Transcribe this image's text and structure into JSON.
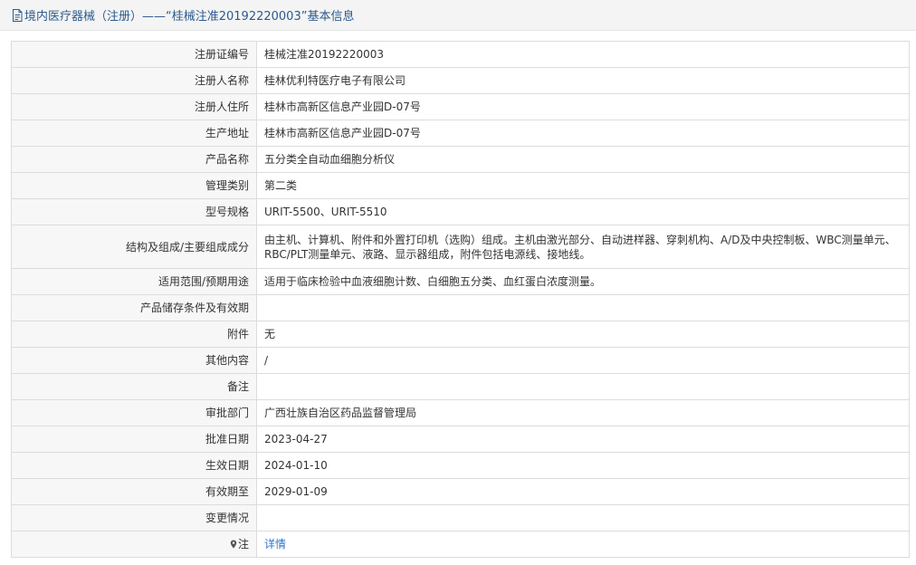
{
  "header": {
    "title": "境内医疗器械（注册）——“桂械注准20192220003”基本信息",
    "icon": "document-icon"
  },
  "rows": [
    {
      "label": "注册证编号",
      "value": "桂械注准20192220003"
    },
    {
      "label": "注册人名称",
      "value": "桂林优利特医疗电子有限公司"
    },
    {
      "label": "注册人住所",
      "value": "桂林市高新区信息产业园D-07号"
    },
    {
      "label": "生产地址",
      "value": "桂林市高新区信息产业园D-07号"
    },
    {
      "label": "产品名称",
      "value": "五分类全自动血细胞分析仪"
    },
    {
      "label": "管理类别",
      "value": "第二类"
    },
    {
      "label": "型号规格",
      "value": "URIT-5500、URIT-5510"
    },
    {
      "label": "结构及组成/主要组成成分",
      "value": "由主机、计算机、附件和外置打印机（选购）组成。主机由激光部分、自动进样器、穿刺机构、A/D及中央控制板、WBC测量单元、RBC/PLT测量单元、液路、显示器组成，附件包括电源线、接地线。"
    },
    {
      "label": "适用范围/预期用途",
      "value": "适用于临床检验中血液细胞计数、白细胞五分类、血红蛋白浓度测量。"
    },
    {
      "label": "产品储存条件及有效期",
      "value": ""
    },
    {
      "label": "附件",
      "value": "无"
    },
    {
      "label": "其他内容",
      "value": "/"
    },
    {
      "label": "备注",
      "value": ""
    },
    {
      "label": "审批部门",
      "value": "广西壮族自治区药品监督管理局"
    },
    {
      "label": "批准日期",
      "value": "2023-04-27"
    },
    {
      "label": "生效日期",
      "value": "2024-01-10"
    },
    {
      "label": "有效期至",
      "value": "2029-01-09"
    },
    {
      "label": "变更情况",
      "value": ""
    }
  ],
  "note_row": {
    "label": "注",
    "icon": "map-pin-icon",
    "link_label": "详情"
  },
  "colors": {
    "header_text": "#2c5a8c",
    "link": "#2a75c7",
    "label_bg": "#f7f7f7",
    "border": "#dcdcdc"
  }
}
